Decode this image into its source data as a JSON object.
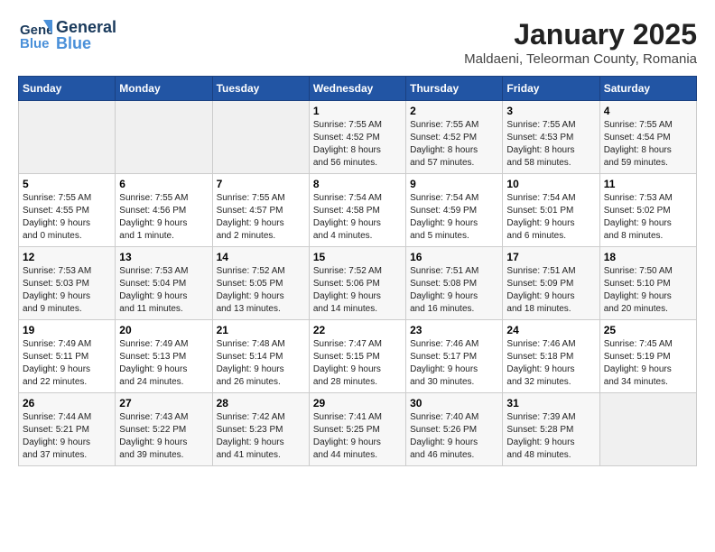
{
  "header": {
    "logo_general": "General",
    "logo_blue": "Blue",
    "month_title": "January 2025",
    "subtitle": "Maldaeni, Teleorman County, Romania"
  },
  "days_of_week": [
    "Sunday",
    "Monday",
    "Tuesday",
    "Wednesday",
    "Thursday",
    "Friday",
    "Saturday"
  ],
  "weeks": [
    [
      {
        "day": "",
        "info": ""
      },
      {
        "day": "",
        "info": ""
      },
      {
        "day": "",
        "info": ""
      },
      {
        "day": "1",
        "info": "Sunrise: 7:55 AM\nSunset: 4:52 PM\nDaylight: 8 hours\nand 56 minutes."
      },
      {
        "day": "2",
        "info": "Sunrise: 7:55 AM\nSunset: 4:52 PM\nDaylight: 8 hours\nand 57 minutes."
      },
      {
        "day": "3",
        "info": "Sunrise: 7:55 AM\nSunset: 4:53 PM\nDaylight: 8 hours\nand 58 minutes."
      },
      {
        "day": "4",
        "info": "Sunrise: 7:55 AM\nSunset: 4:54 PM\nDaylight: 8 hours\nand 59 minutes."
      }
    ],
    [
      {
        "day": "5",
        "info": "Sunrise: 7:55 AM\nSunset: 4:55 PM\nDaylight: 9 hours\nand 0 minutes."
      },
      {
        "day": "6",
        "info": "Sunrise: 7:55 AM\nSunset: 4:56 PM\nDaylight: 9 hours\nand 1 minute."
      },
      {
        "day": "7",
        "info": "Sunrise: 7:55 AM\nSunset: 4:57 PM\nDaylight: 9 hours\nand 2 minutes."
      },
      {
        "day": "8",
        "info": "Sunrise: 7:54 AM\nSunset: 4:58 PM\nDaylight: 9 hours\nand 4 minutes."
      },
      {
        "day": "9",
        "info": "Sunrise: 7:54 AM\nSunset: 4:59 PM\nDaylight: 9 hours\nand 5 minutes."
      },
      {
        "day": "10",
        "info": "Sunrise: 7:54 AM\nSunset: 5:01 PM\nDaylight: 9 hours\nand 6 minutes."
      },
      {
        "day": "11",
        "info": "Sunrise: 7:53 AM\nSunset: 5:02 PM\nDaylight: 9 hours\nand 8 minutes."
      }
    ],
    [
      {
        "day": "12",
        "info": "Sunrise: 7:53 AM\nSunset: 5:03 PM\nDaylight: 9 hours\nand 9 minutes."
      },
      {
        "day": "13",
        "info": "Sunrise: 7:53 AM\nSunset: 5:04 PM\nDaylight: 9 hours\nand 11 minutes."
      },
      {
        "day": "14",
        "info": "Sunrise: 7:52 AM\nSunset: 5:05 PM\nDaylight: 9 hours\nand 13 minutes."
      },
      {
        "day": "15",
        "info": "Sunrise: 7:52 AM\nSunset: 5:06 PM\nDaylight: 9 hours\nand 14 minutes."
      },
      {
        "day": "16",
        "info": "Sunrise: 7:51 AM\nSunset: 5:08 PM\nDaylight: 9 hours\nand 16 minutes."
      },
      {
        "day": "17",
        "info": "Sunrise: 7:51 AM\nSunset: 5:09 PM\nDaylight: 9 hours\nand 18 minutes."
      },
      {
        "day": "18",
        "info": "Sunrise: 7:50 AM\nSunset: 5:10 PM\nDaylight: 9 hours\nand 20 minutes."
      }
    ],
    [
      {
        "day": "19",
        "info": "Sunrise: 7:49 AM\nSunset: 5:11 PM\nDaylight: 9 hours\nand 22 minutes."
      },
      {
        "day": "20",
        "info": "Sunrise: 7:49 AM\nSunset: 5:13 PM\nDaylight: 9 hours\nand 24 minutes."
      },
      {
        "day": "21",
        "info": "Sunrise: 7:48 AM\nSunset: 5:14 PM\nDaylight: 9 hours\nand 26 minutes."
      },
      {
        "day": "22",
        "info": "Sunrise: 7:47 AM\nSunset: 5:15 PM\nDaylight: 9 hours\nand 28 minutes."
      },
      {
        "day": "23",
        "info": "Sunrise: 7:46 AM\nSunset: 5:17 PM\nDaylight: 9 hours\nand 30 minutes."
      },
      {
        "day": "24",
        "info": "Sunrise: 7:46 AM\nSunset: 5:18 PM\nDaylight: 9 hours\nand 32 minutes."
      },
      {
        "day": "25",
        "info": "Sunrise: 7:45 AM\nSunset: 5:19 PM\nDaylight: 9 hours\nand 34 minutes."
      }
    ],
    [
      {
        "day": "26",
        "info": "Sunrise: 7:44 AM\nSunset: 5:21 PM\nDaylight: 9 hours\nand 37 minutes."
      },
      {
        "day": "27",
        "info": "Sunrise: 7:43 AM\nSunset: 5:22 PM\nDaylight: 9 hours\nand 39 minutes."
      },
      {
        "day": "28",
        "info": "Sunrise: 7:42 AM\nSunset: 5:23 PM\nDaylight: 9 hours\nand 41 minutes."
      },
      {
        "day": "29",
        "info": "Sunrise: 7:41 AM\nSunset: 5:25 PM\nDaylight: 9 hours\nand 44 minutes."
      },
      {
        "day": "30",
        "info": "Sunrise: 7:40 AM\nSunset: 5:26 PM\nDaylight: 9 hours\nand 46 minutes."
      },
      {
        "day": "31",
        "info": "Sunrise: 7:39 AM\nSunset: 5:28 PM\nDaylight: 9 hours\nand 48 minutes."
      },
      {
        "day": "",
        "info": ""
      }
    ]
  ]
}
